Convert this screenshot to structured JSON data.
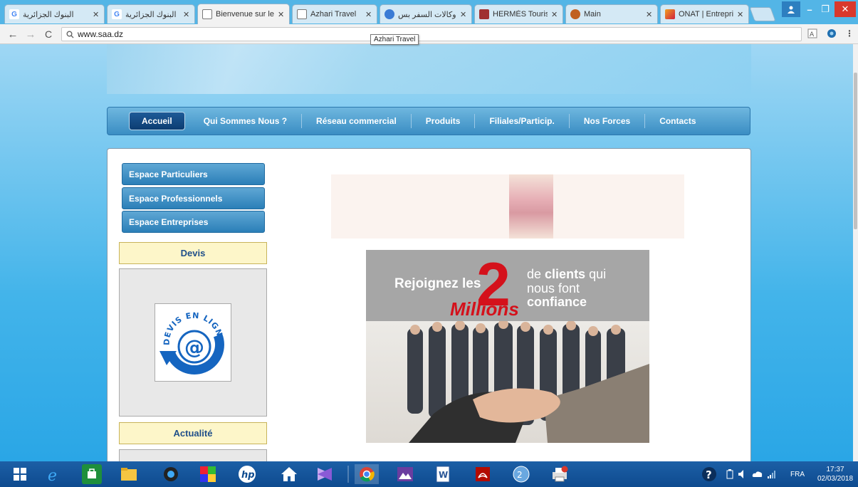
{
  "browser": {
    "tabs": [
      {
        "title": "البنوك الجزائرية",
        "favicon": "google-g",
        "color": "#4285f4"
      },
      {
        "title": "البنوك الجزائرية",
        "favicon": "google-g",
        "color": "#4285f4"
      },
      {
        "title": "Bienvenue sur le",
        "favicon": "page-icon",
        "color": "#888888",
        "active": true
      },
      {
        "title": "Azhari Travel",
        "favicon": "page-icon",
        "color": "#888888"
      },
      {
        "title": "وكالات السفر بس",
        "favicon": "globe-icon",
        "color": "#3a7bd5"
      },
      {
        "title": "HERMÈS Touris",
        "favicon": "hermes-logo",
        "color": "#a03030"
      },
      {
        "title": "Main",
        "favicon": "main-logo",
        "color": "#c06020"
      },
      {
        "title": "ONAT | Entrepri",
        "favicon": "onat-logo",
        "color": "#d02040"
      }
    ],
    "url": "www.saa.dz",
    "tooltip": "Azhari Travel"
  },
  "site": {
    "nav": [
      {
        "label": "Accueil",
        "active": true
      },
      {
        "label": "Qui Sommes Nous ?"
      },
      {
        "label": "Réseau commercial"
      },
      {
        "label": "Produits"
      },
      {
        "label": "Filiales/Particip."
      },
      {
        "label": "Nos Forces"
      },
      {
        "label": "Contacts"
      }
    ],
    "sidebar": {
      "espace_particuliers": "Espace Particuliers",
      "espace_professionnels": "Espace Professionnels",
      "espace_entreprises": "Espace Entreprises",
      "devis_title": "Devis",
      "devis_badge": "DEVIS EN LIGNE",
      "actualite_title": "Actualité"
    },
    "promo": {
      "line1": "Rejoignez les",
      "big_number": "2",
      "millions": "Millions",
      "de": "de",
      "clients": "clients",
      "qui": "qui",
      "nous_font": "nous font",
      "confiance": "confiance"
    }
  },
  "taskbar": {
    "language": "FRA",
    "time": "17:37",
    "date": "02/03/2018"
  },
  "colors": {
    "tabstrip": "#53b5e6",
    "nav_blue": "#3a8dc3",
    "nav_active": "#0c3d72",
    "sidebar_blue": "#2b7fb8",
    "promo_red": "#d4111b",
    "taskbar": "#0e4b8f"
  }
}
